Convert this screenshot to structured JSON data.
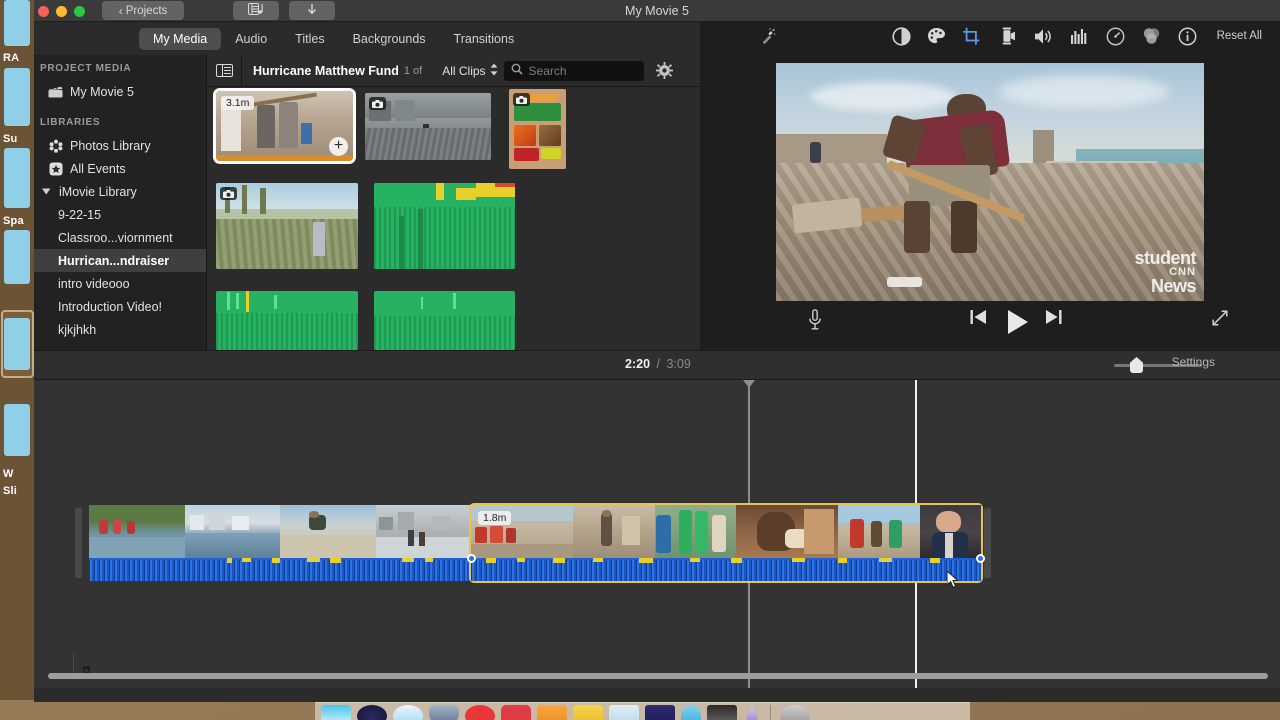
{
  "app": {
    "window_title": "My Movie 5",
    "titlebar_buttons": [
      {
        "name": "back-to-projects",
        "label": "Projects",
        "icon": "chevron-left-icon"
      },
      {
        "name": "media-browser",
        "label": "",
        "icon": "media-browser-icon"
      },
      {
        "name": "share",
        "label": "",
        "icon": "download-arrow-icon"
      }
    ]
  },
  "tabs": [
    {
      "label": "My Media",
      "active": true
    },
    {
      "label": "Audio",
      "active": false
    },
    {
      "label": "Titles",
      "active": false
    },
    {
      "label": "Backgrounds",
      "active": false
    },
    {
      "label": "Transitions",
      "active": false
    }
  ],
  "sidebar": {
    "project_media_header": "PROJECT MEDIA",
    "project_media_items": [
      {
        "label": "My Movie 5",
        "icon": "clapperboard-icon",
        "selected": false
      }
    ],
    "libraries_header": "LIBRARIES",
    "library_items": [
      {
        "label": "Photos Library",
        "icon": "photos-icon",
        "selected": false,
        "child": false
      },
      {
        "label": "All Events",
        "icon": "star-icon",
        "selected": false,
        "child": false
      },
      {
        "label": "iMovie Library",
        "icon": "disclosure-triangle-icon",
        "selected": false,
        "child": false
      },
      {
        "label": "9-22-15",
        "icon": "",
        "selected": false,
        "child": true
      },
      {
        "label": "Classroo...viornment",
        "icon": "",
        "selected": false,
        "child": true
      },
      {
        "label": "Hurrican...ndraiser",
        "icon": "",
        "selected": true,
        "child": true
      },
      {
        "label": "intro videooo",
        "icon": "",
        "selected": false,
        "child": true
      },
      {
        "label": "Introduction Video!",
        "icon": "",
        "selected": false,
        "child": true
      },
      {
        "label": "kjkjhkh",
        "icon": "",
        "selected": false,
        "child": true
      }
    ]
  },
  "browser": {
    "list_view_icon": "list-view-icon",
    "event_title": "Hurricane Matthew Fund",
    "event_count": "1 of",
    "filter_label": "All Clips",
    "filter_icon": "updown-chevron-icon",
    "search_placeholder": "Search",
    "search_icon": "search-icon",
    "search_value": "",
    "settings_icon": "gear-icon",
    "clips": [
      {
        "name": "clip-thumb-1",
        "duration_badge": "3.1m",
        "type": "video",
        "selected": true,
        "has_camera_icon": false,
        "has_add_button": true
      },
      {
        "name": "clip-thumb-2",
        "duration_badge": "",
        "type": "video",
        "selected": false,
        "has_camera_icon": true,
        "has_add_button": false
      },
      {
        "name": "clip-thumb-3",
        "duration_badge": "",
        "type": "poster",
        "selected": false,
        "has_camera_icon": true,
        "has_add_button": false
      },
      {
        "name": "clip-thumb-4",
        "duration_badge": "",
        "type": "video",
        "selected": false,
        "has_camera_icon": true,
        "has_add_button": false
      },
      {
        "name": "clip-thumb-5",
        "duration_badge": "",
        "type": "audio",
        "selected": false,
        "has_camera_icon": false,
        "has_add_button": false
      },
      {
        "name": "clip-thumb-6",
        "duration_badge": "",
        "type": "audio",
        "selected": false,
        "has_camera_icon": false,
        "has_add_button": false
      },
      {
        "name": "clip-thumb-7",
        "duration_badge": "",
        "type": "audio",
        "selected": false,
        "has_camera_icon": false,
        "has_add_button": false
      }
    ]
  },
  "viewer": {
    "tools": [
      {
        "name": "enhance-button",
        "icon": "magic-wand-icon",
        "active": false
      },
      {
        "name": "color-balance-button",
        "icon": "color-balance-icon",
        "active": false
      },
      {
        "name": "color-correction-button",
        "icon": "palette-icon",
        "active": false
      },
      {
        "name": "crop-button",
        "icon": "crop-icon",
        "active": true
      },
      {
        "name": "stabilization-button",
        "icon": "camera-icon",
        "active": false
      },
      {
        "name": "volume-button",
        "icon": "speaker-icon",
        "active": false
      },
      {
        "name": "noise-reduction-button",
        "icon": "equalizer-icon",
        "active": false
      },
      {
        "name": "speed-button",
        "icon": "speedometer-icon",
        "active": false
      },
      {
        "name": "clip-filter-button",
        "icon": "filter-circles-icon",
        "active": false
      },
      {
        "name": "info-button",
        "icon": "info-circle-icon",
        "active": false
      }
    ],
    "reset_all_label": "Reset All",
    "watermark_line1": "student",
    "watermark_line2": "CNN",
    "watermark_line3": "News",
    "controls": [
      {
        "name": "voiceover-button",
        "icon": "microphone-icon"
      },
      {
        "name": "skip-to-start-button",
        "icon": "skip-back-icon"
      },
      {
        "name": "play-button",
        "icon": "play-icon"
      },
      {
        "name": "skip-to-end-button",
        "icon": "skip-forward-icon"
      },
      {
        "name": "fullscreen-button",
        "icon": "expand-arrows-icon"
      }
    ]
  },
  "timeline_toolbar": {
    "current_time": "2:20",
    "time_separator": "/",
    "total_time": "3:09",
    "settings_label": "Settings",
    "zoom_slider_value": 18
  },
  "timeline": {
    "clips": [
      {
        "name": "timeline-clip-1",
        "duration_badge": "",
        "selected": false
      },
      {
        "name": "timeline-clip-2",
        "duration_badge": "1.8m",
        "selected": true
      }
    ],
    "music_track_icon": "music-note-icon"
  },
  "colors": {
    "selection_yellow": "#e8c44a",
    "audio_blue": "#1f5fd0",
    "audio_green": "#27b263",
    "accent_blue": "#5a9ae8",
    "window_bg": "#2b2b2b"
  }
}
